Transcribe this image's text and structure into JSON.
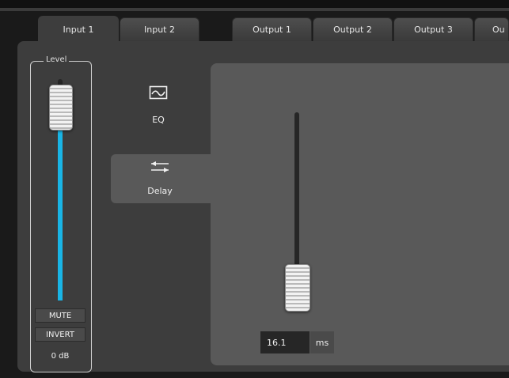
{
  "tabs": [
    {
      "label": "Input 1",
      "active": true
    },
    {
      "label": "Input 2",
      "active": false
    },
    {
      "label": "Output 1",
      "active": false
    },
    {
      "label": "Output 2",
      "active": false
    },
    {
      "label": "Output 3",
      "active": false
    },
    {
      "label": "Ou",
      "active": false
    }
  ],
  "level": {
    "label": "Level",
    "mute_label": "MUTE",
    "invert_label": "INVERT",
    "value": "0 dB",
    "fader_fraction": 0.87
  },
  "side_nav": {
    "eq": {
      "label": "EQ",
      "icon": "eq-curve-icon"
    },
    "delay": {
      "label": "Delay",
      "icon": "delay-arrows-icon"
    }
  },
  "delay": {
    "value": "16.1",
    "unit": "ms",
    "fader_fraction": 0.12
  },
  "colors": {
    "accent": "#19b5e6",
    "panel": "#595959",
    "background": "#3d3d3d"
  }
}
